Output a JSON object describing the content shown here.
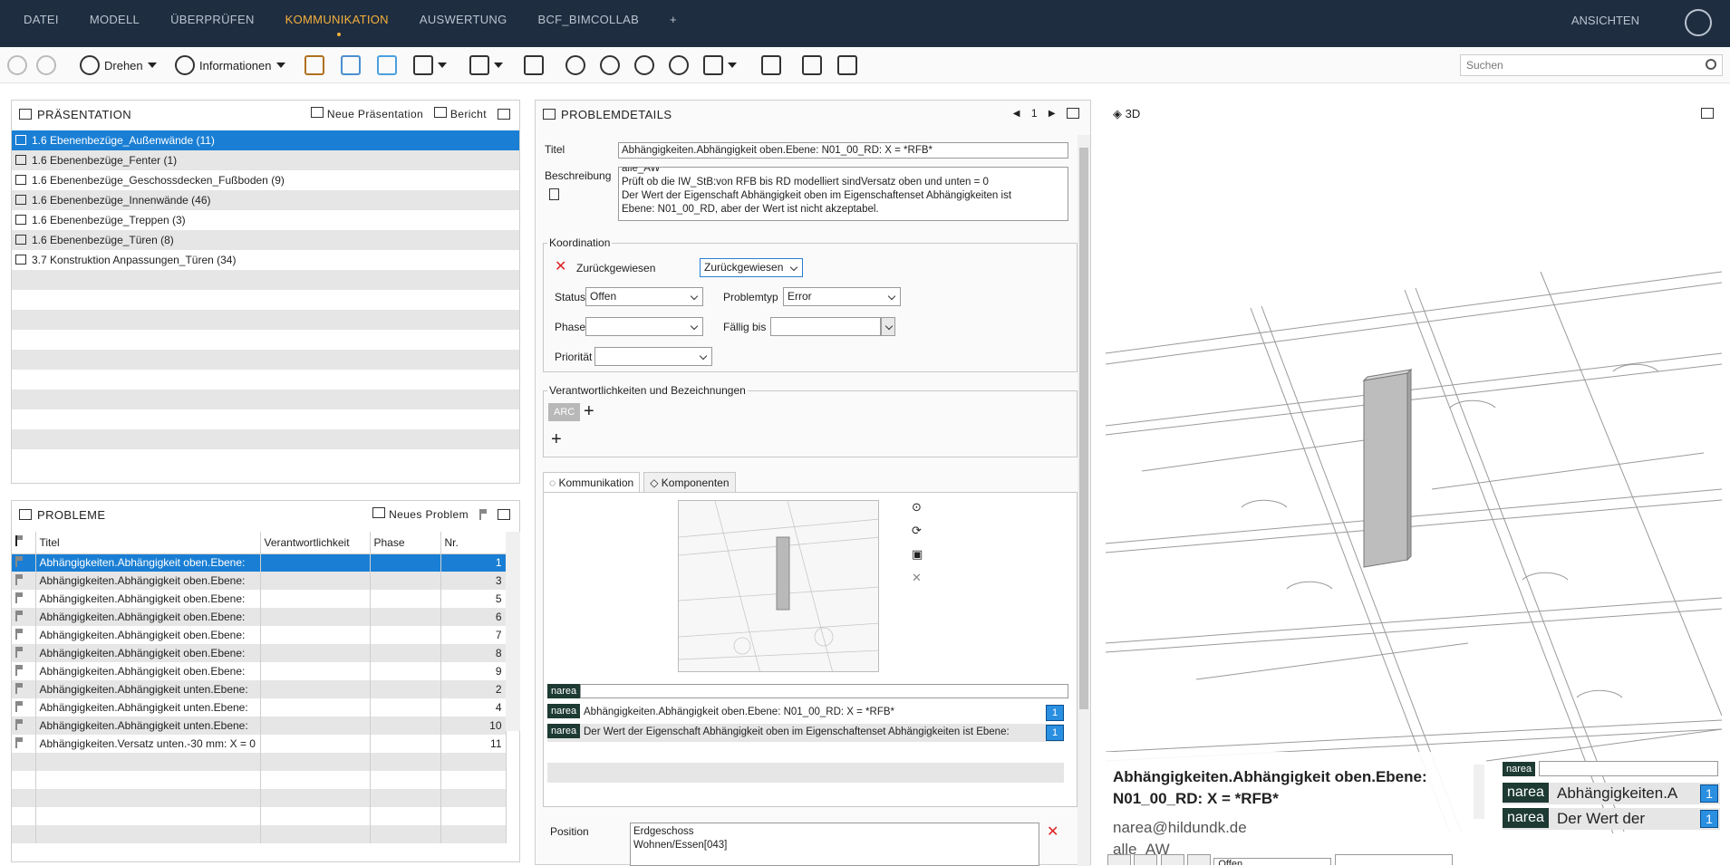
{
  "menu": {
    "items": [
      "DATEI",
      "MODELL",
      "ÜBERPRÜFEN",
      "KOMMUNIKATION",
      "AUSWERTUNG",
      "BCF_BIMCOLLAB",
      "+"
    ],
    "active": "KOMMUNIKATION",
    "views": "ANSICHTEN"
  },
  "toolbar": {
    "rotate_label": "Drehen",
    "info_label": "Informationen",
    "search_placeholder": "Suchen"
  },
  "presentation": {
    "title": "PRÄSENTATION",
    "new_label": "Neue Präsentation",
    "report_label": "Bericht",
    "items": [
      "1.6 Ebenenbezüge_Außenwände (11)",
      "1.6 Ebenenbezüge_Fenter (1)",
      "1.6 Ebenenbezüge_Geschossdecken_Fußboden (9)",
      "1.6 Ebenenbezüge_Innenwände (46)",
      "1.6 Ebenenbezüge_Treppen (3)",
      "1.6 Ebenenbezüge_Türen (8)",
      "3.7 Konstruktion Anpassungen_Türen (34)"
    ]
  },
  "problems": {
    "title": "PROBLEME",
    "new_label": "Neues Problem",
    "columns": [
      "Titel",
      "Verantwortlichkeit",
      "Phase",
      "Nr."
    ],
    "rows": [
      {
        "title": "Abhängigkeiten.Abhängigkeit oben.Ebene:",
        "nr": "1"
      },
      {
        "title": "Abhängigkeiten.Abhängigkeit oben.Ebene:",
        "nr": "3"
      },
      {
        "title": "Abhängigkeiten.Abhängigkeit oben.Ebene:",
        "nr": "5"
      },
      {
        "title": "Abhängigkeiten.Abhängigkeit oben.Ebene:",
        "nr": "6"
      },
      {
        "title": "Abhängigkeiten.Abhängigkeit oben.Ebene:",
        "nr": "7"
      },
      {
        "title": "Abhängigkeiten.Abhängigkeit oben.Ebene:",
        "nr": "8"
      },
      {
        "title": "Abhängigkeiten.Abhängigkeit oben.Ebene:",
        "nr": "9"
      },
      {
        "title": "Abhängigkeiten.Abhängigkeit unten.Ebene:",
        "nr": "2"
      },
      {
        "title": "Abhängigkeiten.Abhängigkeit unten.Ebene:",
        "nr": "4"
      },
      {
        "title": "Abhängigkeiten.Abhängigkeit unten.Ebene:",
        "nr": "10"
      },
      {
        "title": "Abhängigkeiten.Versatz unten.-30 mm: X = 0",
        "nr": "11"
      }
    ]
  },
  "details": {
    "title": "PROBLEMDETAILS",
    "page": "1",
    "title_label": "Titel",
    "title_value": "Abhängigkeiten.Abhängigkeit oben.Ebene: N01_00_RD: X = *RFB*",
    "desc_label": "Beschreibung",
    "desc_lines": [
      "alle_AW",
      "Prüft ob die IW_StB:von RFB bis RD modelliert sindVersatz oben und unten = 0",
      "Der Wert der Eigenschaft Abhängigkeit oben im Eigenschaftenset Abhängigkeiten ist",
      "Ebene: N01_00_RD, aber der Wert ist nicht akzeptabel."
    ],
    "coordination_label": "Koordination",
    "rejected_label": "Zurückgewiesen",
    "rejected_value": "Zurückgewiesen",
    "status_label": "Status",
    "status_value": "Offen",
    "problemtype_label": "Problemtyp",
    "problemtype_value": "Error",
    "phase_label": "Phase",
    "phase_value": "",
    "due_label": "Fällig bis",
    "due_value": "",
    "priority_label": "Priorität",
    "priority_value": "",
    "responsibilities_label": "Verantwortlichkeiten und Bezeichnungen",
    "arc_tag": "ARC",
    "tab_communication": "Kommunikation",
    "tab_components": "Komponenten",
    "comment_tag": "narea",
    "comments": [
      {
        "text": "Abhängigkeiten.Abhängigkeit oben.Ebene: N01_00_RD: X = *RFB*",
        "count": "1"
      },
      {
        "text": "Der Wert der Eigenschaft Abhängigkeit oben im Eigenschaftenset Abhängigkeiten ist Ebene:",
        "count": "1"
      }
    ],
    "position_label": "Position",
    "position_lines": [
      "Erdgeschoss",
      "Wohnen/Essen[043]"
    ]
  },
  "view3d": {
    "title": "3D",
    "overlay_title_line1": "Abhängigkeiten.Abhängigkeit oben.Ebene:",
    "overlay_title_line2": "N01_00_RD: X = *RFB*",
    "overlay_email": "narea@hildundk.de",
    "overlay_extra": "alle_AW",
    "overlay_tag": "narea",
    "overlay_comment1": "Abhängigkeiten.A",
    "overlay_comment2": "Der Wert der",
    "overlay_count": "1",
    "bottom_select": "Offen"
  }
}
